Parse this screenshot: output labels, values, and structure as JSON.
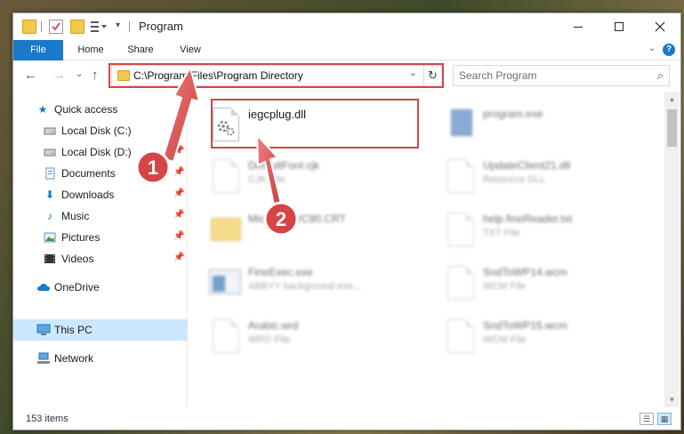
{
  "window": {
    "title": "Program"
  },
  "ribbon": {
    "tabs": [
      {
        "label": "File"
      },
      {
        "label": "Home"
      },
      {
        "label": "Share"
      },
      {
        "label": "View"
      }
    ]
  },
  "address": {
    "path": "C:\\Program Files\\Program Directory",
    "search_placeholder": "Search Program"
  },
  "sidebar": {
    "items": [
      {
        "label": "Quick access",
        "icon": "star-icon",
        "pinned": false
      },
      {
        "label": "Local Disk (C:)",
        "icon": "drive-icon",
        "pinned": true
      },
      {
        "label": "Local Disk (D:)",
        "icon": "drive-icon",
        "pinned": true
      },
      {
        "label": "Documents",
        "icon": "documents-icon",
        "pinned": true
      },
      {
        "label": "Downloads",
        "icon": "download-icon",
        "pinned": true
      },
      {
        "label": "Music",
        "icon": "music-icon",
        "pinned": true
      },
      {
        "label": "Pictures",
        "icon": "pictures-icon",
        "pinned": true
      },
      {
        "label": "Videos",
        "icon": "videos-icon",
        "pinned": true
      },
      {
        "label": "OneDrive",
        "icon": "cloud-icon",
        "pinned": false
      },
      {
        "label": "This PC",
        "icon": "computer-icon",
        "pinned": false,
        "selected": true
      },
      {
        "label": "Network",
        "icon": "network-icon",
        "pinned": false
      }
    ]
  },
  "files": [
    {
      "name": "iegcplug.dll",
      "type": "",
      "highlighted": true
    },
    {
      "name": "program.exe",
      "type": ""
    },
    {
      "name": "DefaultFont.cjk",
      "type": "CJK File"
    },
    {
      "name": "UpdateClient21.dll",
      "type": "Resource DLL"
    },
    {
      "name": "Microsoft.VC90.CRT",
      "type": ""
    },
    {
      "name": "help.fineReader.txt",
      "type": "TXT File"
    },
    {
      "name": "FineExec.exe",
      "type": "ABBYY background exe..."
    },
    {
      "name": "SndToWP14.wcm",
      "type": "WCM File"
    },
    {
      "name": "Arabic.wrd",
      "type": "WRD File"
    },
    {
      "name": "SndToWP15.wcm",
      "type": "WCM File"
    }
  ],
  "status": {
    "count": "153 items"
  },
  "annotations": {
    "step1": "1",
    "step2": "2"
  },
  "colors": {
    "accent": "#1979ca",
    "highlight": "#d64545",
    "selection": "#cce8ff"
  }
}
